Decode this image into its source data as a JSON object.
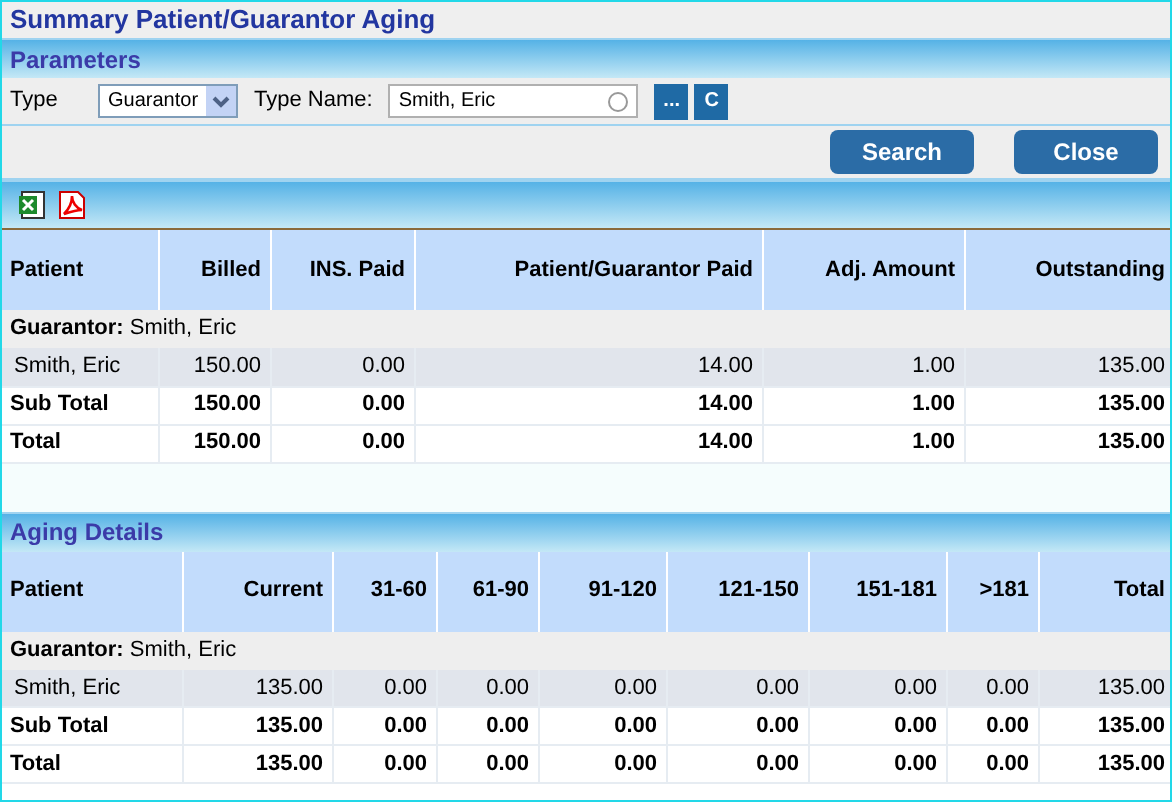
{
  "title": "Summary Patient/Guarantor Aging",
  "parameters": {
    "heading": "Parameters",
    "type_label": "Type",
    "type_value": "Guarantor",
    "type_name_label": "Type Name:",
    "type_name_value": "Smith, Eric",
    "buttons": [
      "...",
      "C"
    ]
  },
  "actions": [
    "Search",
    "Close"
  ],
  "summary": {
    "columns": [
      "Patient",
      "Billed",
      "INS. Paid",
      "Patient/Guarantor Paid",
      "Adj. Amount",
      "Outstanding"
    ],
    "group": "**Guarantor:** Smith, Eric",
    "rows": [
      {
        "kind": "data",
        "cells": [
          "Smith, Eric",
          "150.00",
          "0.00",
          "14.00",
          "1.00",
          "135.00"
        ]
      },
      {
        "kind": "total",
        "cells": [
          "Sub Total",
          "150.00",
          "0.00",
          "14.00",
          "1.00",
          "135.00"
        ]
      },
      {
        "kind": "total",
        "cells": [
          "Total",
          "150.00",
          "0.00",
          "14.00",
          "1.00",
          "135.00"
        ]
      }
    ]
  },
  "aging": {
    "heading": "Aging Details",
    "columns": [
      "Patient",
      "Current",
      "31-60",
      "61-90",
      "91-120",
      "121-150",
      "151-181",
      ">181",
      "Total"
    ],
    "group": "**Guarantor:** Smith, Eric",
    "rows": [
      {
        "kind": "data",
        "cells": [
          "Smith, Eric",
          "135.00",
          "0.00",
          "0.00",
          "0.00",
          "0.00",
          "0.00",
          "0.00",
          "135.00"
        ]
      },
      {
        "kind": "total",
        "cells": [
          "Sub Total",
          "135.00",
          "0.00",
          "0.00",
          "0.00",
          "0.00",
          "0.00",
          "0.00",
          "135.00"
        ]
      },
      {
        "kind": "total",
        "cells": [
          "Total",
          "135.00",
          "0.00",
          "0.00",
          "0.00",
          "0.00",
          "0.00",
          "0.00",
          "135.00"
        ]
      }
    ]
  }
}
